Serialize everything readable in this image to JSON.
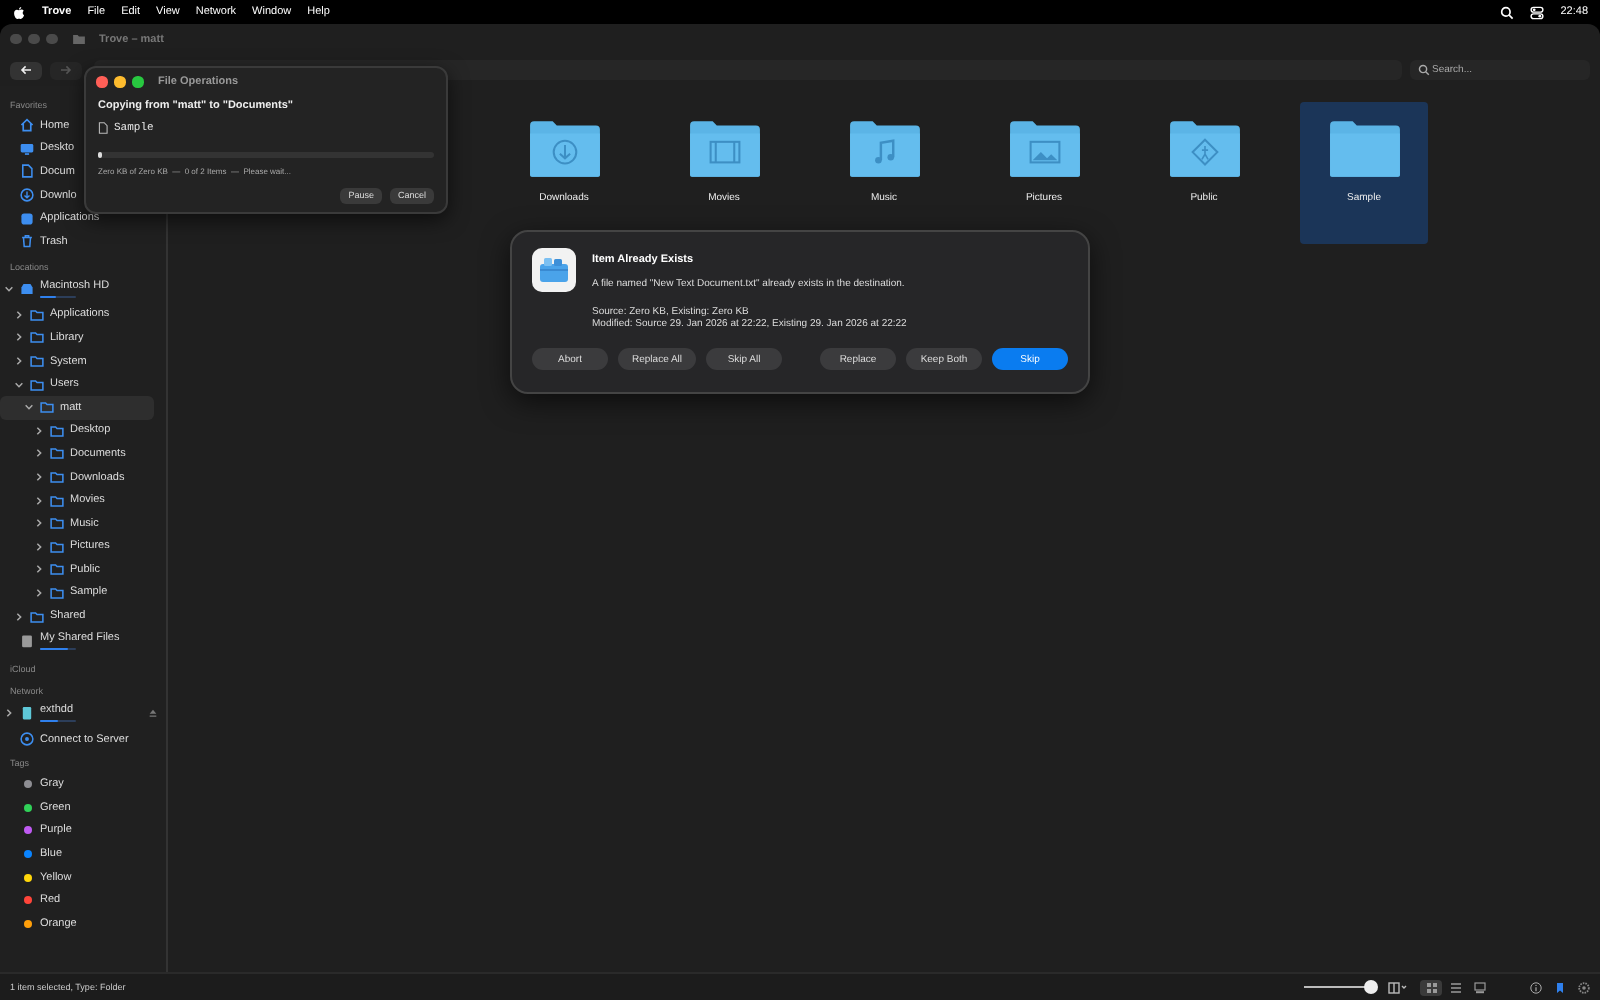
{
  "menu_bar": {
    "app": "Trove",
    "menus": [
      "File",
      "Edit",
      "View",
      "Network",
      "Window",
      "Help"
    ],
    "clock": "22:48"
  },
  "window": {
    "title": "Trove – matt"
  },
  "toolbar": {
    "back_enabled": true,
    "forward_enabled": false,
    "search": {
      "placeholder": "Search..."
    }
  },
  "sidebar": {
    "sections": [
      {
        "title": "Favorites",
        "items": [
          {
            "label": "Home",
            "kind": "home"
          },
          {
            "label": "Deskto",
            "kind": "desktop"
          },
          {
            "label": "Docum",
            "kind": "documents"
          },
          {
            "label": "Downlo",
            "kind": "downloads"
          },
          {
            "label": "Applications",
            "kind": "applications"
          },
          {
            "label": "Trash",
            "kind": "trash"
          }
        ]
      },
      {
        "title": "Locations",
        "items": [
          {
            "label": "Macintosh HD",
            "kind": "disk",
            "level": 0.45,
            "expanded": true,
            "selected": false,
            "children": [
              {
                "label": "Applications",
                "kind": "folder",
                "expanded": false,
                "selected": false
              },
              {
                "label": "Library",
                "kind": "folder",
                "expanded": false,
                "selected": false
              },
              {
                "label": "System",
                "kind": "folder",
                "expanded": false,
                "selected": false
              },
              {
                "label": "Users",
                "kind": "folder",
                "expanded": true,
                "selected": false,
                "children": [
                  {
                    "label": "matt",
                    "kind": "folder",
                    "expanded": true,
                    "selected": true,
                    "children": [
                      {
                        "label": "Desktop",
                        "kind": "folder",
                        "expanded": false,
                        "selected": false
                      },
                      {
                        "label": "Documents",
                        "kind": "folder",
                        "expanded": false,
                        "selected": false
                      },
                      {
                        "label": "Downloads",
                        "kind": "folder",
                        "expanded": false,
                        "selected": false
                      },
                      {
                        "label": "Movies",
                        "kind": "folder",
                        "expanded": false,
                        "selected": false
                      },
                      {
                        "label": "Music",
                        "kind": "folder",
                        "expanded": false,
                        "selected": false
                      },
                      {
                        "label": "Pictures",
                        "kind": "folder",
                        "expanded": false,
                        "selected": false
                      },
                      {
                        "label": "Public",
                        "kind": "folder",
                        "expanded": false,
                        "selected": false
                      },
                      {
                        "label": "Sample",
                        "kind": "folder",
                        "expanded": false,
                        "selected": false
                      }
                    ]
                  }
                ]
              },
              {
                "label": "Shared",
                "kind": "folder",
                "expanded": false,
                "selected": false
              }
            ]
          },
          {
            "label": "My Shared Files",
            "kind": "shared",
            "level": 0.75
          }
        ]
      },
      {
        "title": "iCloud"
      },
      {
        "title": "Network",
        "items": [
          {
            "label": "exthdd",
            "kind": "network",
            "level": 0.5,
            "expanded": false,
            "selected": false
          },
          {
            "label": "Connect to Server",
            "kind": "connect"
          }
        ]
      },
      {
        "title": "Tags",
        "items": [
          {
            "label": "Gray",
            "kind": "tag",
            "color": "#8e8e93"
          },
          {
            "label": "Green",
            "kind": "tag",
            "color": "#30d158"
          },
          {
            "label": "Purple",
            "kind": "tag",
            "color": "#bf5af2"
          },
          {
            "label": "Blue",
            "kind": "tag",
            "color": "#0a84ff"
          },
          {
            "label": "Yellow",
            "kind": "tag",
            "color": "#ffd60a"
          },
          {
            "label": "Red",
            "kind": "tag",
            "color": "#ff453a"
          },
          {
            "label": "Orange",
            "kind": "tag",
            "color": "#ff9f0a"
          }
        ]
      }
    ]
  },
  "content": {
    "items": [
      {
        "label": "Downloads",
        "kind": "downloads",
        "selected": false
      },
      {
        "label": "Movies",
        "kind": "movies",
        "selected": false
      },
      {
        "label": "Music",
        "kind": "music",
        "selected": false
      },
      {
        "label": "Pictures",
        "kind": "pictures",
        "selected": false
      },
      {
        "label": "Public",
        "kind": "public",
        "selected": false
      },
      {
        "label": "Sample",
        "kind": "plain",
        "selected": true
      }
    ]
  },
  "file_operations": {
    "title": "File Operations",
    "heading": "Copying from \"matt\" to \"Documents\"",
    "file": "Sample",
    "level": 0.01,
    "status": "Zero KB of Zero KB  —  0 of 2 Items  —  Please wait...",
    "buttons": [
      "Pause",
      "Cancel"
    ]
  },
  "alert": {
    "title": "Item Already Exists",
    "message": "A file named \"New Text Document.txt\" already exists in the destination.",
    "details": [
      "Source: Zero KB, Existing: Zero KB",
      "Modified: Source 29. Jan 2026 at 22:22, Existing 29. Jan 2026 at 22:22"
    ],
    "button_groups": [
      [
        {
          "label": "Abort",
          "default": false
        },
        {
          "label": "Replace All",
          "default": false
        },
        {
          "label": "Skip All",
          "default": false
        }
      ],
      [
        {
          "label": "Replace",
          "default": false
        },
        {
          "label": "Keep Both",
          "default": false
        },
        {
          "label": "Skip",
          "default": true
        }
      ]
    ]
  },
  "status_bar": {
    "text": "1 item selected, Type: Folder",
    "zoom": {
      "level": 0.92
    },
    "views": [
      {
        "kind": "icons",
        "selected": true
      },
      {
        "kind": "list",
        "selected": false
      },
      {
        "kind": "gallery",
        "selected": false
      }
    ]
  }
}
